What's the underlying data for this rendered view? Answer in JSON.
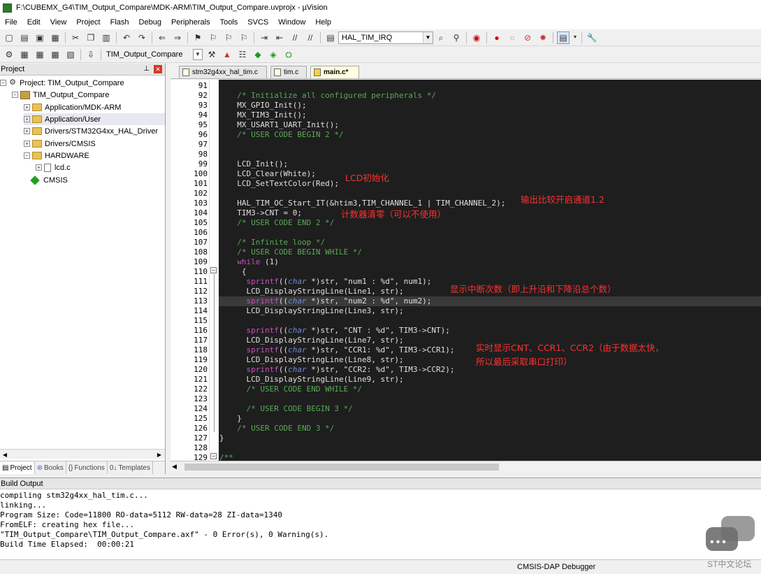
{
  "window": {
    "title": "F:\\CUBEMX_G4\\TIM_Output_Compare\\MDK-ARM\\TIM_Output_Compare.uvprojx - µVision"
  },
  "menu": [
    "File",
    "Edit",
    "View",
    "Project",
    "Flash",
    "Debug",
    "Peripherals",
    "Tools",
    "SVCS",
    "Window",
    "Help"
  ],
  "toolbar": {
    "find_value": "HAL_TIM_IRQ",
    "target_value": "TIM_Output_Compare"
  },
  "project_panel": {
    "header": "Project",
    "tree": [
      "Project: TIM_Output_Compare",
      "TIM_Output_Compare",
      "Application/MDK-ARM",
      "Application/User",
      "Drivers/STM32G4xx_HAL_Driver",
      "Drivers/CMSIS",
      "HARDWARE",
      "lcd.c",
      "CMSIS"
    ],
    "tabs": [
      "Project",
      "Books",
      "Functions",
      "Templates"
    ]
  },
  "editor": {
    "tabs": [
      "stm32g4xx_hal_tim.c",
      "tim.c",
      "main.c*"
    ],
    "line_numbers": [
      "91",
      "92",
      "93",
      "94",
      "95",
      "96",
      "97",
      "98",
      "99",
      "100",
      "101",
      "102",
      "103",
      "104",
      "105",
      "106",
      "107",
      "108",
      "109",
      "110",
      "111",
      "112",
      "113",
      "114",
      "115",
      "116",
      "117",
      "118",
      "119",
      "120",
      "121",
      "122",
      "123",
      "124",
      "125",
      "126",
      "127",
      "128",
      "129"
    ],
    "code": {
      "l92": "  /* Initialize all configured peripherals */",
      "l93": "  MX_GPIO_Init();",
      "l94": "  MX_TIM3_Init();",
      "l95": "  MX_USART1_UART_Init();",
      "l96": "  /* USER CODE BEGIN 2 */",
      "l99": "  LCD_Init();",
      "l100": "  LCD_Clear(White);",
      "l101": "  LCD_SetTextColor(Red);",
      "l103": "  HAL_TIM_OC_Start_IT(&htim3,TIM_CHANNEL_1 | TIM_CHANNEL_2);",
      "l104": "  TIM3->CNT = 0;",
      "l105": "  /* USER CODE END 2 */",
      "l107": "  /* Infinite loop */",
      "l108": "  /* USER CODE BEGIN WHILE */",
      "l109_kw": "while",
      "l109_rest": " (1)",
      "l110": "   {",
      "l111_kw": "sprintf",
      "l111_a": "((",
      "l111_type": "char",
      "l111_b": " *)str, \"num1 : %d\", num1);",
      "l112": "    LCD_DisplayStringLine(Line1, str);",
      "l113_kw": "sprintf",
      "l113_a": "((",
      "l113_type": "char",
      "l113_b": " *)str, \"num2 : %d\", num2);",
      "l114": "    LCD_DisplayStringLine(Line3, str);",
      "l116_kw": "sprintf",
      "l116_a": "((",
      "l116_type": "char",
      "l116_b": " *)str, \"CNT : %d\", TIM3->CNT);",
      "l117": "    LCD_DisplayStringLine(Line7, str);",
      "l118_kw": "sprintf",
      "l118_a": "((",
      "l118_type": "char",
      "l118_b": " *)str, \"CCR1: %d\", TIM3->CCR1);",
      "l119": "    LCD_DisplayStringLine(Line8, str);",
      "l120_kw": "sprintf",
      "l120_a": "((",
      "l120_type": "char",
      "l120_b": " *)str, \"CCR2: %d\", TIM3->CCR2);",
      "l121": "    LCD_DisplayStringLine(Line9, str);",
      "l122": "    /* USER CODE END WHILE */",
      "l124": "    /* USER CODE BEGIN 3 */",
      "l125": "  }",
      "l126": "  /* USER CODE END 3 */",
      "l127": "}",
      "l129": "/**"
    },
    "annotations": {
      "lcd_init": "LCD初始化",
      "oc_start": "输出比较开启通道1.2",
      "cnt_clear": "计数器清零（可以不使用）",
      "interrupt_count": "显示中断次数（即上升沿和下降沿总个数）",
      "realtime_1": "实时显示CNT、CCR1、CCR2（由于数据太快，",
      "realtime_2": "所以最后采取串口打印）"
    }
  },
  "build_output": {
    "header": "Build Output",
    "lines": [
      "compiling stm32g4xx_hal_tim.c...",
      "linking...",
      "Program Size: Code=11800 RO-data=5112 RW-data=28 ZI-data=1340",
      "FromELF: creating hex file...",
      "\"TIM_Output_Compare\\TIM_Output_Compare.axf\" - 0 Error(s), 0 Warning(s).",
      "Build Time Elapsed:  00:00:21"
    ]
  },
  "status": {
    "debugger": "CMSIS-DAP Debugger"
  },
  "watermark": {
    "text": "ST中文论坛"
  }
}
